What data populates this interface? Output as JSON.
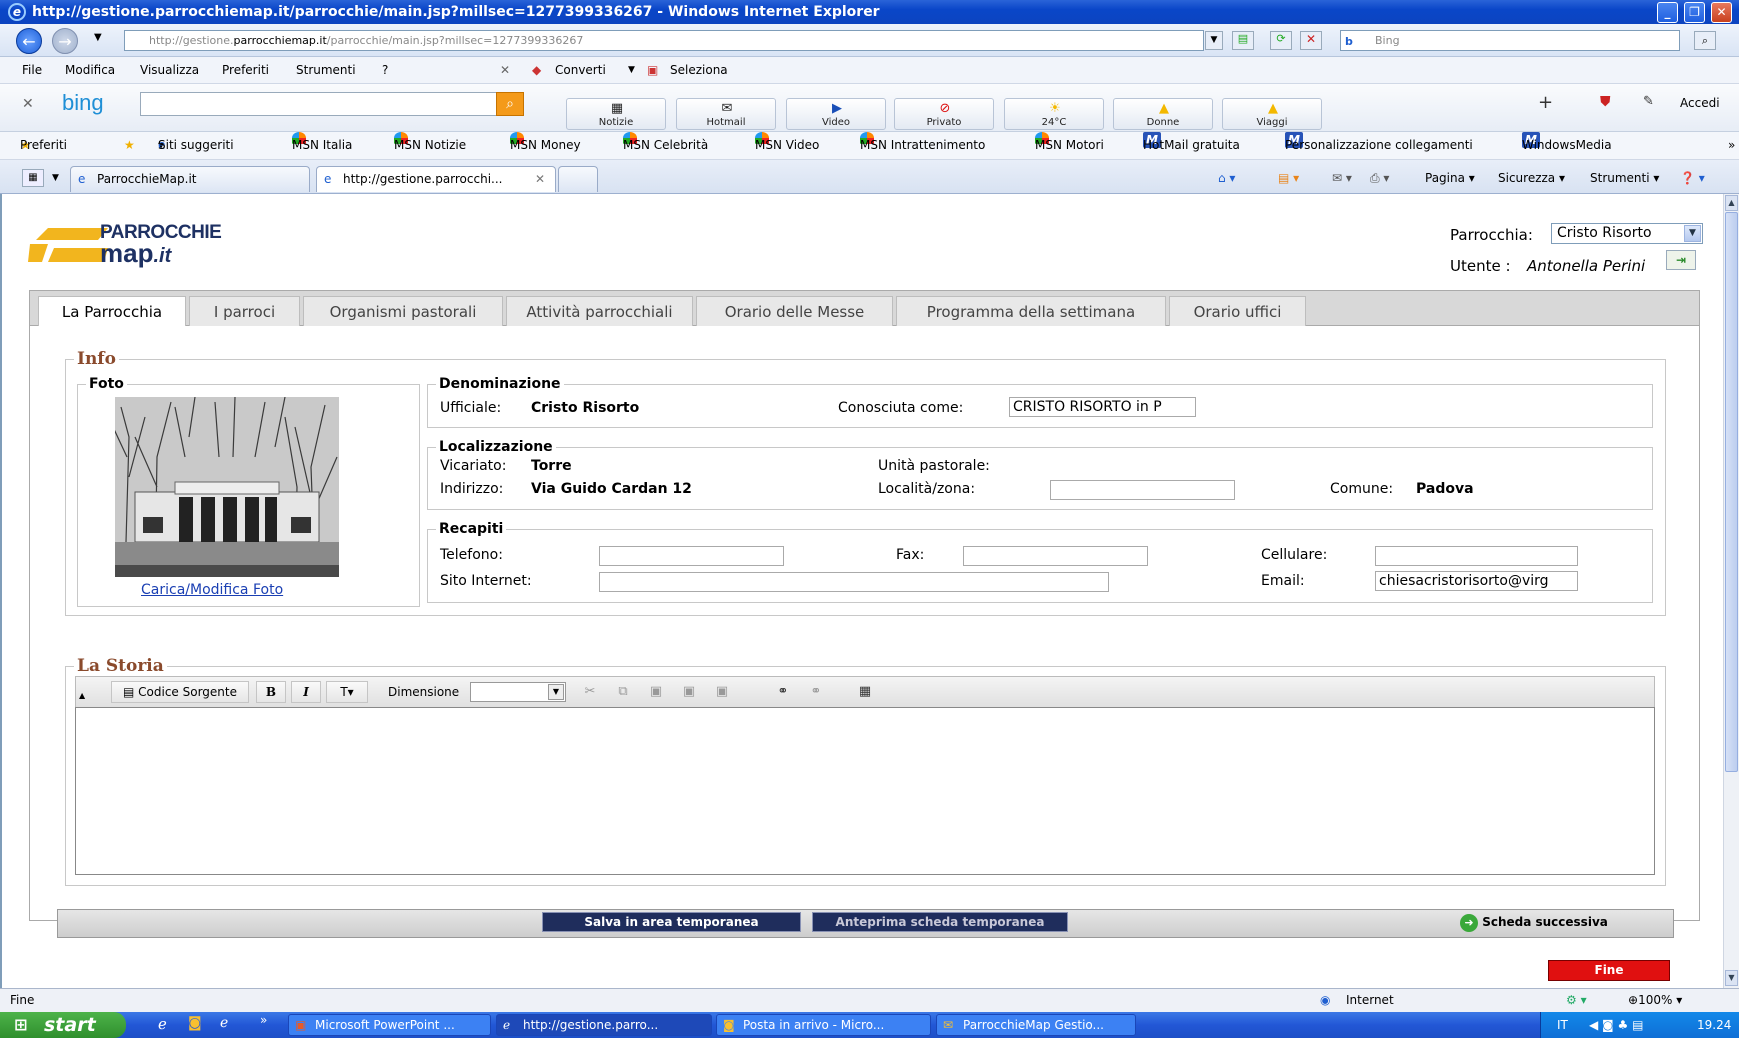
{
  "window": {
    "title": "http://gestione.parrocchiemap.it/parrocchie/main.jsp?millsec=1277399336267 - Windows Internet Explorer"
  },
  "address": {
    "prefix": "http://gestione.",
    "domain": "parrocchiemap.it",
    "path": "/parrocchie/main.jsp?millsec=1277399336267",
    "search_placeholder": "Bing"
  },
  "menu": [
    "File",
    "Modifica",
    "Visualizza",
    "Preferiti",
    "Strumenti",
    "?"
  ],
  "menu_extra": {
    "converti": "Converti",
    "seleziona": "Seleziona"
  },
  "bingbar": {
    "logo": "bing",
    "buttons": [
      "Notizie",
      "Hotmail",
      "Video",
      "Privato",
      "24°C",
      "Donne",
      "Viaggi"
    ],
    "accedi": "Accedi"
  },
  "favorites": [
    "Preferiti",
    "Siti suggeriti",
    "MSN Italia",
    "MSN Notizie",
    "MSN Money",
    "MSN Celebrità",
    "MSN Video",
    "MSN Intrattenimento",
    "MSN Motori",
    "HotMail gratuita",
    "Personalizzazione collegamenti",
    "WindowsMedia"
  ],
  "browser_tabs": [
    "ParrocchieMap.it",
    "http://gestione.parrocchi..."
  ],
  "commandbar": {
    "pagina": "Pagina",
    "sicurezza": "Sicurezza",
    "strumenti": "Strumenti"
  },
  "app": {
    "logo_top": "PARROCCHIE",
    "logo_bottom": "map",
    "logo_suffix": ".it",
    "parrocchia_label": "Parrocchia:",
    "parrocchia_value": "Cristo Risorto",
    "utente_label": "Utente :",
    "utente_value": "Antonella Perini",
    "tabs": [
      "La Parrocchia",
      "I parroci",
      "Organismi pastorali",
      "Attività parrocchiali",
      "Orario delle Messe",
      "Programma della settimana",
      "Orario uffici"
    ],
    "info_legend": "Info",
    "foto_legend": "Foto",
    "foto_link": "Carica/Modifica Foto",
    "denominazione": {
      "legend": "Denominazione",
      "ufficiale_label": "Ufficiale:",
      "ufficiale_value": "Cristo Risorto",
      "conosciuta_label": "Conosciuta come:",
      "conosciuta_value": "CRISTO RISORTO in P"
    },
    "localizzazione": {
      "legend": "Localizzazione",
      "vicariato_label": "Vicariato:",
      "vicariato_value": "Torre",
      "unita_label": "Unità pastorale:",
      "indirizzo_label": "Indirizzo:",
      "indirizzo_value": "Via Guido Cardan 12",
      "localita_label": "Località/zona:",
      "localita_value": "",
      "comune_label": "Comune:",
      "comune_value": "Padova"
    },
    "recapiti": {
      "legend": "Recapiti",
      "telefono_label": "Telefono:",
      "fax_label": "Fax:",
      "cellulare_label": "Cellulare:",
      "sito_label": "Sito Internet:",
      "email_label": "Email:",
      "email_value": "chiesacristorisorto@virg",
      "telefono_value": "",
      "fax_value": "",
      "cellulare_value": "",
      "sito_value": ""
    },
    "storia_legend": "La Storia",
    "editor": {
      "codice_sorgente": "Codice Sorgente",
      "bold": "B",
      "italic": "I",
      "dimensione": "Dimensione"
    },
    "buttons": {
      "salva": "Salva in area temporanea",
      "anteprima": "Anteprima scheda temporanea",
      "successiva": "Scheda successiva",
      "fine": "Fine"
    }
  },
  "statusbar": {
    "left": "Fine",
    "zone": "Internet",
    "zoom": "100%"
  },
  "taskbar": {
    "start": "start",
    "tasks": [
      "Microsoft PowerPoint ...",
      "http://gestione.parro...",
      "Posta in arrivo - Micro...",
      "ParrocchieMap Gestio..."
    ],
    "lang": "IT",
    "time": "19.24"
  }
}
